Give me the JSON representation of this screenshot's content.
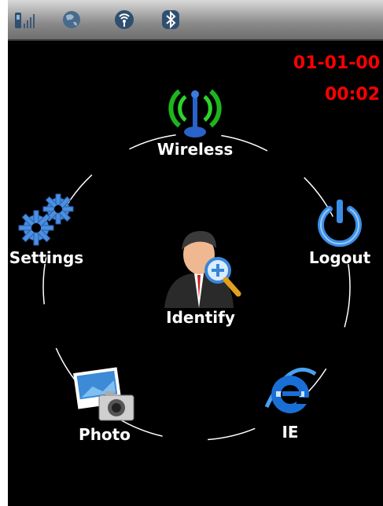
{
  "status_bar": {
    "icons": [
      "signal-icon",
      "network-globe-icon",
      "wifi-icon",
      "bluetooth-icon"
    ]
  },
  "clock": {
    "date": "01-01-00",
    "time": "00:02"
  },
  "menu": {
    "center": {
      "label": "Identify",
      "icon": "identify-user-magnifier-icon"
    },
    "items": [
      {
        "label": "Wireless",
        "icon": "wireless-antenna-icon"
      },
      {
        "label": "Logout",
        "icon": "power-icon"
      },
      {
        "label": "IE",
        "icon": "internet-explorer-icon"
      },
      {
        "label": "Photo",
        "icon": "photo-camera-icon"
      },
      {
        "label": "Settings",
        "icon": "gears-icon"
      }
    ]
  },
  "colors": {
    "clock": "#ff0000",
    "background": "#000000",
    "label": "#ffffff"
  }
}
